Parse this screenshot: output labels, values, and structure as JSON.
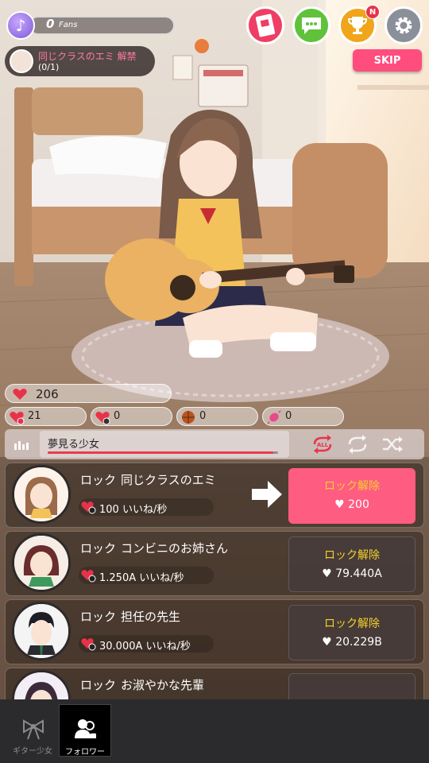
{
  "top": {
    "fans_count": "0",
    "fans_label": "Fans",
    "mission_title": "同じクラスのエミ 解禁",
    "mission_progress": "(0/1)",
    "skip_label": "SKIP",
    "buttons": [
      {
        "name": "ticket-icon",
        "color": "#ef3e64"
      },
      {
        "name": "chat-icon",
        "color": "#5fc23a"
      },
      {
        "name": "trophy-icon",
        "color": "#f0a51a",
        "badge": "N"
      },
      {
        "name": "gear-icon",
        "color": "#8a8f9a"
      }
    ]
  },
  "stats": {
    "hearts": "206",
    "items": [
      "21",
      "0",
      "0",
      "0"
    ]
  },
  "song": {
    "title": "夢見る少女",
    "progress": 0.98,
    "controls": [
      "all-repeat-icon",
      "repeat-icon",
      "shuffle-icon"
    ]
  },
  "followers": [
    {
      "lock": "ロック",
      "name": "同じクラスのエミ",
      "rate": "100 いいね/秒",
      "unlock_label": "ロック解除",
      "cost": "200",
      "highlight": true
    },
    {
      "lock": "ロック",
      "name": "コンビニのお姉さん",
      "rate": "1.250A いいね/秒",
      "unlock_label": "ロック解除",
      "cost": "79.440A",
      "highlight": false
    },
    {
      "lock": "ロック",
      "name": "担任の先生",
      "rate": "30.000A いいね/秒",
      "unlock_label": "ロック解除",
      "cost": "20.229B",
      "highlight": false
    },
    {
      "lock": "ロック",
      "name": "お淑やかな先輩",
      "rate": "",
      "unlock_label": "",
      "cost": "",
      "highlight": false
    }
  ],
  "nav": {
    "tab_guitar": "ギター少女",
    "tab_follower": "フォロワー"
  },
  "colors": {
    "accent_pink": "#ff4d7e",
    "unlock_yellow": "#f5d02e",
    "heart_red": "#e8324a"
  }
}
